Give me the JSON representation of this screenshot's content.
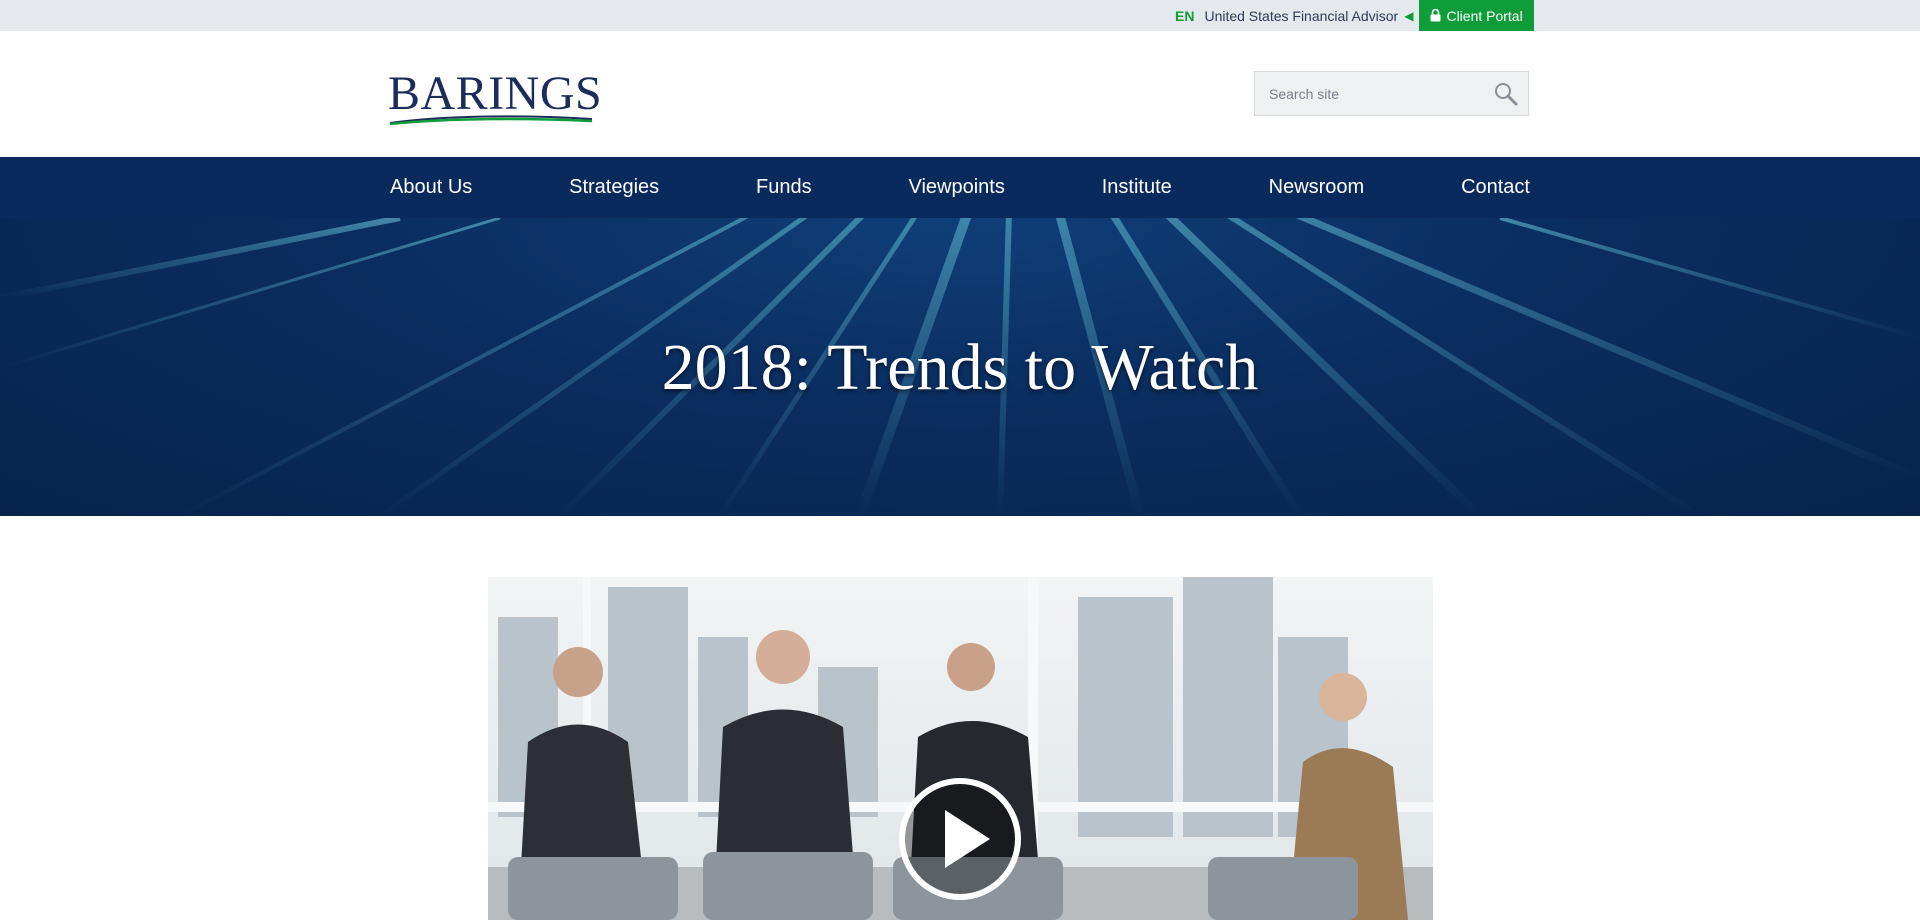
{
  "utility": {
    "language": "EN",
    "region": "United States Financial Advisor",
    "client_portal": "Client Portal"
  },
  "header": {
    "logo_text": "BARINGS",
    "search_placeholder": "Search site"
  },
  "nav": {
    "items": [
      {
        "label": "About Us"
      },
      {
        "label": "Strategies"
      },
      {
        "label": "Funds"
      },
      {
        "label": "Viewpoints"
      },
      {
        "label": "Institute"
      },
      {
        "label": "Newsroom"
      },
      {
        "label": "Contact"
      }
    ]
  },
  "hero": {
    "title": "2018: Trends to Watch"
  },
  "colors": {
    "brand_navy": "#0a2a5e",
    "accent_green": "#0f9d3a",
    "logo_navy": "#1c2c5b"
  },
  "icons": {
    "lock": "lock-icon",
    "search": "search-icon",
    "play": "play-icon",
    "arrow": "caret-left-icon"
  }
}
